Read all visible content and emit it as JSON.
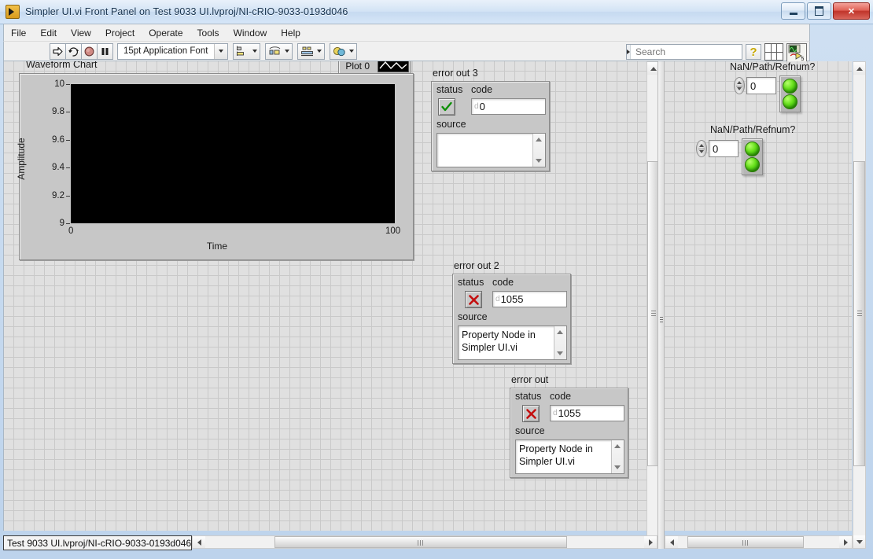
{
  "window": {
    "title": "Simpler UI.vi Front Panel on Test 9033 UI.lvproj/NI-cRIO-9033-0193d046",
    "icon": "labview-vi-icon",
    "minimize_label": "Minimize",
    "maximize_label": "Maximize",
    "close_label": "Close"
  },
  "menu": {
    "items": [
      {
        "label": "File"
      },
      {
        "label": "Edit"
      },
      {
        "label": "View"
      },
      {
        "label": "Project"
      },
      {
        "label": "Operate"
      },
      {
        "label": "Tools"
      },
      {
        "label": "Window"
      },
      {
        "label": "Help"
      }
    ]
  },
  "toolbar": {
    "run_icon": "run-arrow-icon",
    "run_continuous_icon": "run-continuously-icon",
    "abort_icon": "abort-execution-icon",
    "pause_icon": "pause-icon",
    "font_selector_value": "15pt Application Font",
    "align_icon": "align-objects-icon",
    "distribute_icon": "distribute-objects-icon",
    "resize_icon": "resize-objects-icon",
    "reorder_icon": "reorder-objects-icon",
    "help_icon": "context-help-icon",
    "grid_icon": "window-grid-icon",
    "vi_panel_icon": "vi-panel-icon",
    "vi_panel_badge": "5"
  },
  "search": {
    "placeholder": "Search",
    "value": "",
    "icon": "search-icon"
  },
  "chart_data": {
    "type": "line",
    "title": "Waveform Chart",
    "xlabel": "Time",
    "ylabel": "Amplitude",
    "xlim": [
      0,
      100
    ],
    "ylim": [
      9,
      10
    ],
    "x_ticks": [
      "0",
      "100"
    ],
    "y_ticks": [
      "10",
      "9.8",
      "9.6",
      "9.4",
      "9.2",
      "9"
    ],
    "grid": false,
    "plot_background": "#000000",
    "series": [
      {
        "name": "Plot 0",
        "values": [],
        "color": "#ffffff"
      }
    ],
    "legend": {
      "position": "top-right",
      "entries": [
        "Plot 0"
      ]
    }
  },
  "error_clusters": [
    {
      "caption": "error out 3",
      "status_label": "status",
      "status_state": "ok",
      "status_icon": "green-check-icon",
      "code_label": "code",
      "code_radix": "d",
      "code_value": "0",
      "source_label": "source",
      "source_value": ""
    },
    {
      "caption": "error out 2",
      "status_label": "status",
      "status_state": "error",
      "status_icon": "red-x-icon",
      "code_label": "code",
      "code_radix": "d",
      "code_value": "1055",
      "source_label": "source",
      "source_value": "Property Node in\nSimpler UI.vi"
    },
    {
      "caption": "error out",
      "status_label": "status",
      "status_state": "error",
      "status_icon": "red-x-icon",
      "code_label": "code",
      "code_radix": "d",
      "code_value": "1055",
      "source_label": "source",
      "source_value": "Property Node in\nSimpler UI.vi"
    }
  ],
  "nan_clusters": [
    {
      "caption": "NaN/Path/Refnum?",
      "numeric_value": "0",
      "leds": [
        "on",
        "on"
      ],
      "led_color": "#4ecc17"
    },
    {
      "caption": "NaN/Path/Refnum?",
      "numeric_value": "0",
      "leds": [
        "on",
        "on"
      ],
      "led_color": "#4ecc17"
    }
  ],
  "statusbar": {
    "target": "Test 9033 UI.lvproj/NI-cRIO-9033-0193d046"
  },
  "scrollbars": {
    "left_vertical": "left-panel-vertical-scrollbar",
    "left_horizontal": "left-panel-horizontal-scrollbar",
    "right_vertical": "right-panel-vertical-scrollbar",
    "right_horizontal": "right-panel-horizontal-scrollbar"
  },
  "colors": {
    "panel_background": "#e0e0e0",
    "grid_line": "#c9c9c9",
    "control_face": "#c7c7c7",
    "plot_background": "#000000",
    "led_green": "#4ecc17",
    "error_red": "#cc1111",
    "ok_green": "#1aa30a"
  }
}
